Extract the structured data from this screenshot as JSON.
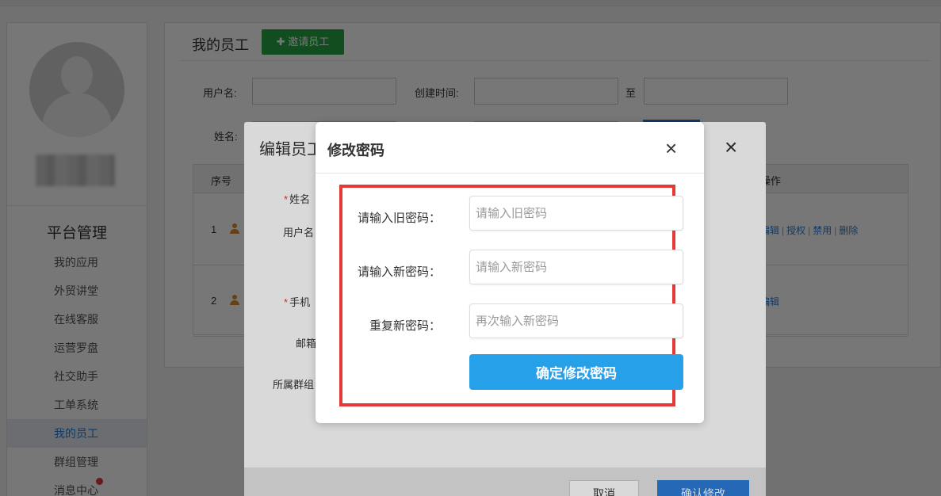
{
  "sidebar": {
    "title": "平台管理",
    "items": [
      {
        "label": "我的应用"
      },
      {
        "label": "外贸讲堂"
      },
      {
        "label": "在线客服"
      },
      {
        "label": "运营罗盘"
      },
      {
        "label": "社交助手"
      },
      {
        "label": "工单系统"
      },
      {
        "label": "我的员工"
      },
      {
        "label": "群组管理"
      },
      {
        "label": "消息中心"
      }
    ],
    "active_item": "我的员工"
  },
  "main": {
    "title": "我的员工",
    "invite_button": "✚ 邀请员工",
    "filters": {
      "username_label": "用户名:",
      "created_label": "创建时间:",
      "to_label": "至",
      "name_label": "姓名:"
    },
    "table": {
      "headers": {
        "index": "序号",
        "ops": "操作"
      },
      "rows": [
        {
          "index": "1",
          "ops": [
            "编辑",
            "授权",
            "禁用",
            "删除"
          ]
        },
        {
          "index": "2",
          "ops": [
            "编辑"
          ]
        }
      ]
    }
  },
  "edit_modal": {
    "title": "编辑员工",
    "labels": {
      "name": "姓名",
      "username": "用户名",
      "phone": "手机",
      "email": "邮箱",
      "group": "所属群组"
    },
    "cancel": "取消",
    "confirm": "确认修改"
  },
  "password_modal": {
    "title": "修改密码",
    "close_icon": "×",
    "fields": [
      {
        "label": "请输入旧密码：",
        "placeholder": "请输入旧密码"
      },
      {
        "label": "请输入新密码：",
        "placeholder": "请输入新密码"
      },
      {
        "label": "重复新密码：",
        "placeholder": "再次输入新密码"
      }
    ],
    "submit": "确定修改密码",
    "highlight_color": "#e53935",
    "submit_color": "#27a0ea"
  },
  "colors": {
    "primary": "#2b7bd6",
    "success": "#28a745",
    "danger": "#e53935"
  }
}
